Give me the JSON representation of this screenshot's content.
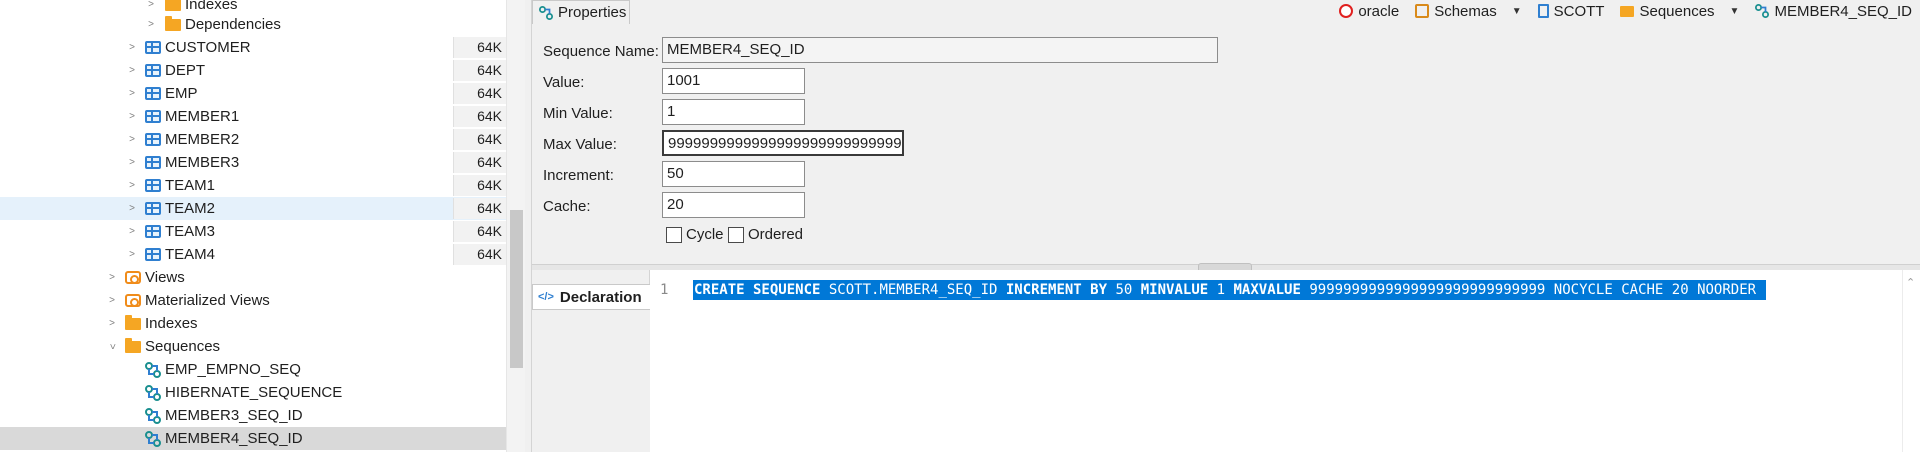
{
  "tree": {
    "rows": [
      {
        "label": "Indexes",
        "size": ""
      },
      {
        "label": "Dependencies",
        "size": ""
      },
      {
        "label": "CUSTOMER",
        "size": "64K"
      },
      {
        "label": "DEPT",
        "size": "64K"
      },
      {
        "label": "EMP",
        "size": "64K"
      },
      {
        "label": "MEMBER1",
        "size": "64K"
      },
      {
        "label": "MEMBER2",
        "size": "64K"
      },
      {
        "label": "MEMBER3",
        "size": "64K"
      },
      {
        "label": "TEAM1",
        "size": "64K"
      },
      {
        "label": "TEAM2",
        "size": "64K"
      },
      {
        "label": "TEAM3",
        "size": "64K"
      },
      {
        "label": "TEAM4",
        "size": "64K"
      },
      {
        "label": "Views",
        "size": ""
      },
      {
        "label": "Materialized Views",
        "size": ""
      },
      {
        "label": "Indexes",
        "size": ""
      },
      {
        "label": "Sequences",
        "size": ""
      },
      {
        "label": "EMP_EMPNO_SEQ",
        "size": ""
      },
      {
        "label": "HIBERNATE_SEQUENCE",
        "size": ""
      },
      {
        "label": "MEMBER3_SEQ_ID",
        "size": ""
      },
      {
        "label": "MEMBER4_SEQ_ID",
        "size": ""
      }
    ],
    "icons": {
      "chevron_right": "chevron-right-icon",
      "chevron_down": "chevron-down-icon",
      "table": "table-icon",
      "folder": "folder-icon",
      "view": "view-icon",
      "sequence": "sequence-icon"
    }
  },
  "editor": {
    "tab_label": "Properties",
    "breadcrumb": {
      "connection": "oracle",
      "schemas": "Schemas",
      "schema": "SCOTT",
      "sequences": "Sequences",
      "object": "MEMBER4_SEQ_ID"
    },
    "form": {
      "name_label": "Sequence Name:",
      "name_value": "MEMBER4_SEQ_ID",
      "value_label": "Value:",
      "value_value": "1001",
      "min_label": "Min Value:",
      "min_value": "1",
      "max_label": "Max Value:",
      "max_value": "9999999999999999999999999999",
      "increment_label": "Increment:",
      "increment_value": "50",
      "cache_label": "Cache:",
      "cache_value": "20",
      "cycle_label": "Cycle",
      "cycle_checked": false,
      "ordered_label": "Ordered",
      "ordered_checked": false
    },
    "declaration": {
      "tab_label": "Declaration",
      "line_number": "1",
      "sql": {
        "kw1": "CREATE SEQUENCE",
        "t1": " SCOTT.MEMBER4_SEQ_ID ",
        "kw2": "INCREMENT BY",
        "t2": " 50 ",
        "kw3": "MINVALUE",
        "t3": " 1 ",
        "kw4": "MAXVALUE",
        "t4": " 9999999999999999999999999999 NOCYCLE CACHE 20 NOORDER"
      }
    }
  },
  "colors": {
    "selection": "#0078d7",
    "table_icon": "#2f7fd0",
    "folder_icon": "#f5a623",
    "sequence_icon": "#1a8f8f",
    "oracle_icon": "#e0201f"
  }
}
